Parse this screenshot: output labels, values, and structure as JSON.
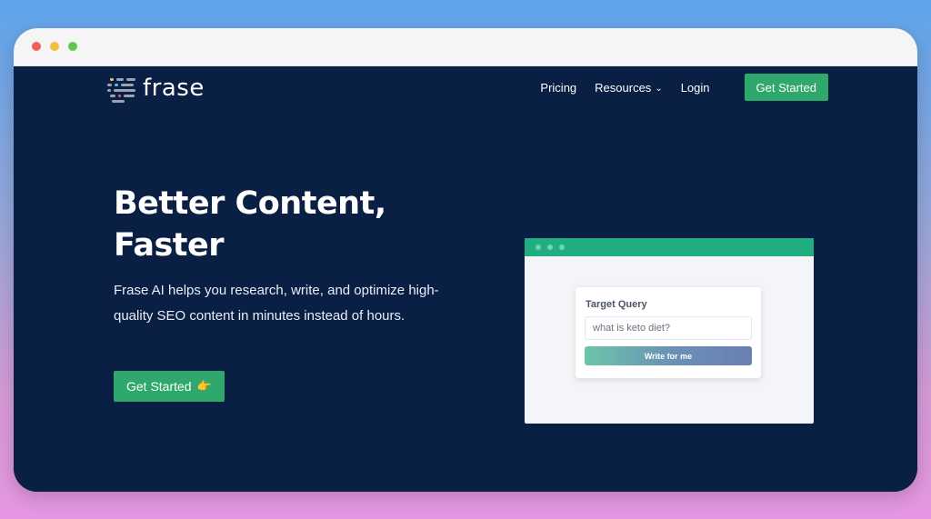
{
  "brand": {
    "name": "frase",
    "accent": "#2fa86c",
    "background": "#0a1f44",
    "logo_icon": "frase-logo-icon"
  },
  "nav": {
    "items": [
      {
        "label": "Pricing"
      },
      {
        "label": "Resources",
        "icon": "chevron-down-icon"
      },
      {
        "label": "Login"
      }
    ],
    "cta_label": "Get Started"
  },
  "hero": {
    "title_line1": "Better Content,",
    "title_line2": "Faster",
    "subtitle": "Frase AI helps you research, write, and optimize high-quality SEO content in minutes instead of hours.",
    "cta_label": "Get Started",
    "cta_icon": "pointing-hand-emoji"
  },
  "mockup": {
    "card_label": "Target Query",
    "input_value": "what is keto diet?",
    "button_label": "Write for me"
  }
}
